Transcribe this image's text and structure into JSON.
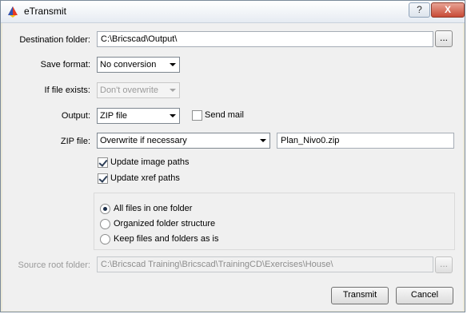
{
  "window": {
    "title": "eTransmit",
    "help_label": "?",
    "close_label": "X"
  },
  "destination_folder": {
    "label": "Destination folder:",
    "value": "C:\\Bricscad\\Output\\",
    "browse_label": "..."
  },
  "save_format": {
    "label": "Save format:",
    "value": "No conversion"
  },
  "if_file_exists": {
    "label": "If file exists:",
    "value": "Don't overwrite"
  },
  "output": {
    "label": "Output:",
    "value": "ZIP file",
    "send_mail_label": "Send mail",
    "send_mail_checked": false
  },
  "zip_file": {
    "label": "ZIP file:",
    "mode": "Overwrite if necessary",
    "name": "Plan_Nivo0.zip"
  },
  "options": {
    "update_image_paths": {
      "label": "Update image paths",
      "checked": true
    },
    "update_xref_paths": {
      "label": "Update xref paths",
      "checked": true
    }
  },
  "folder_structure": {
    "options": [
      {
        "label": "All files in one folder",
        "selected": true
      },
      {
        "label": "Organized folder structure",
        "selected": false
      },
      {
        "label": "Keep files and folders as is",
        "selected": false
      }
    ]
  },
  "source_root": {
    "label": "Source root folder:",
    "value": "C:\\Bricscad Training\\Bricscad\\TrainingCD\\Exercises\\House\\",
    "browse_label": "..."
  },
  "buttons": {
    "transmit": "Transmit",
    "cancel": "Cancel"
  }
}
